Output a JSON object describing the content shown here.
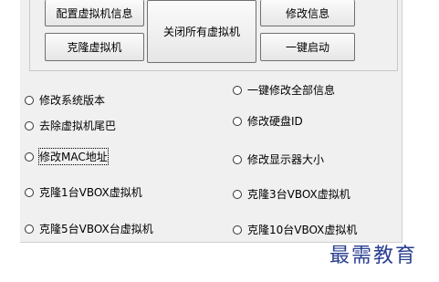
{
  "buttons": {
    "query_vm_info": "配置虚拟机信息",
    "close_all_vms": "关闭所有虚拟机",
    "modify_info": "修改信息",
    "clone_vm": "克隆虚拟机",
    "one_click_start": "一键启动"
  },
  "options": {
    "modify_system_version": "修改系统版本",
    "remove_vm_tail": "去除虚拟机尾巴",
    "modify_mac_address": "修改MAC地址",
    "clone_1_vbox": "克隆1台VBOX虚拟机",
    "clone_5_vbox": "克隆5台VBOX台虚拟机",
    "one_click_modify_all": "一键修改全部信息",
    "modify_hard_disk_id": "修改硬盘ID",
    "modify_display_size": "修改显示器大小",
    "clone_3_vbox": "克隆3台VBOX虚拟机",
    "clone_10_vbox": "克隆10台VBOX虚拟机"
  },
  "watermark": "最需教育",
  "colors": {
    "panel": "#f0f0f0",
    "watermark": "#2a3f8f"
  }
}
